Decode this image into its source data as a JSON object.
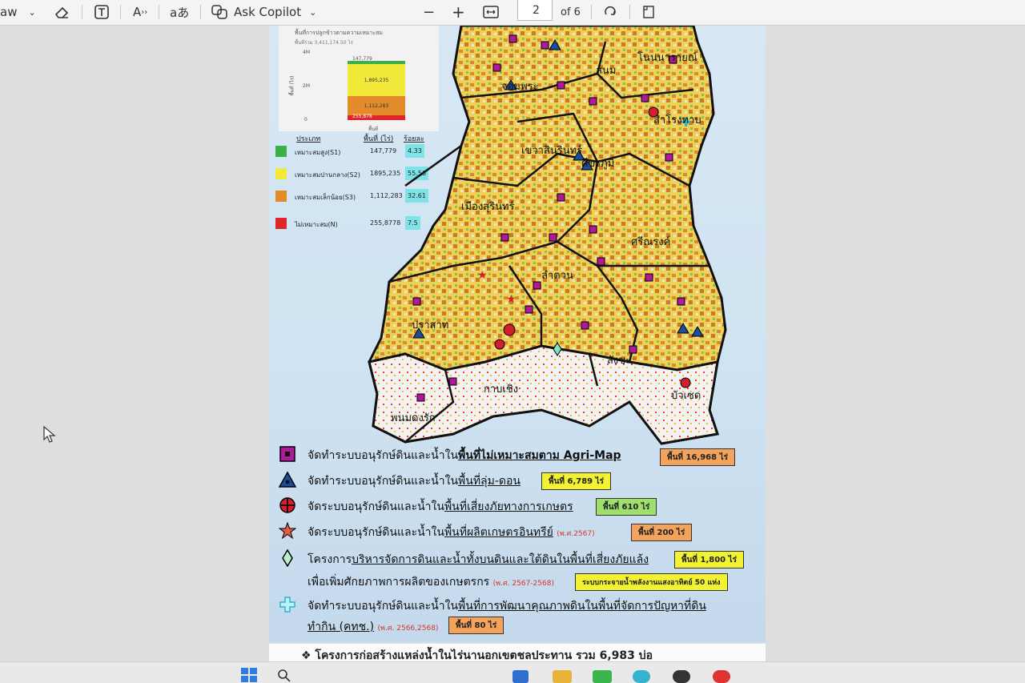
{
  "toolbar": {
    "draw_label": "aw",
    "ask_copilot": "Ask Copilot",
    "page_current": "2",
    "page_of": "of 6",
    "minus": "−",
    "plus": "+"
  },
  "chart": {
    "title": "พื้นที่การปลูกข้าวตามความเหมาะสม",
    "subtitle": "พื้นที่รวม 3,411,174.50 ไร่",
    "yticks": [
      "4M",
      "2M",
      "0"
    ],
    "ylabel": "พื้นที่ (ไร่)",
    "xlabel": "พื้นที่",
    "segments": [
      "147,779",
      "1,895,235",
      "1,112,283",
      "255,878"
    ]
  },
  "legend_table": {
    "col_type": "ประเภท",
    "col_area": "พื้นที่ (ไร่)",
    "col_pct": "ร้อยละ",
    "rows": [
      {
        "name": "เหมาะสมสูง(S1)",
        "area": "147,779",
        "pct": "4.33",
        "color": "#3cae4a"
      },
      {
        "name": "เหมาะสมปานกลาง(S2)",
        "area": "1895,235",
        "pct": "55.56",
        "color": "#f2e93a"
      },
      {
        "name": "เหมาะสมเล็กน้อย(S3)",
        "area": "1,112,283",
        "pct": "32.61",
        "color": "#e38a2b"
      },
      {
        "name": "ไม่เหมาะสม(N)",
        "area": "255,8778",
        "pct": "7.5",
        "color": "#e0262a"
      }
    ]
  },
  "map_labels": [
    "โนนนารายณ์",
    "สนม",
    "สำโรงทาบ",
    "ศีขรภูมิ",
    "เขวาสินรินทร์",
    "เมืองสุรินทร์",
    "ศรีณรงค์",
    "ลำดวน",
    "ปราสาท",
    "สังขะ",
    "กาบเชิง",
    "บัวเชด",
    "พนมดงรัก",
    "จอมพระ"
  ],
  "legend": [
    {
      "pre": "จัดทำระบบอนุรักษ์ดินและน้ำใน",
      "under": "พื้นที่ไม่เหมาะสมตาม Agri-Map",
      "post": "",
      "year": "",
      "badge": "พื้นที่ 16,968 ไร่"
    },
    {
      "pre": "จัดทำระบบอนุรักษ์ดินและน้ำใน",
      "under": "พื้นที่ลุ่ม-ดอน",
      "post": "",
      "year": "",
      "badge": "พื้นที่ 6,789 ไร่"
    },
    {
      "pre": "จัดระบบอนุรักษ์ดินและน้ำใน",
      "under": "พื้นที่เสี่ยงภัยทางการเกษตร",
      "post": "",
      "year": "",
      "badge": "พื้นที่ 610 ไร่"
    },
    {
      "pre": "จัดระบบอนุรักษ์ดินและน้ำใน",
      "under": "พื้นที่ผลิตเกษตรอินทรีย์",
      "post": "",
      "year": "(พ.ศ.2567)",
      "badge": "พื้นที่ 200 ไร่"
    },
    {
      "pre": "โครงการ",
      "under": "บริหารจัดการดินและน้ำทั้งบนดินและใต้ดินในพื้นที่เสี่ยงภัยแล้ง",
      "post": "",
      "year": "",
      "badge": "พื้นที่ 1,800 ไร่",
      "line2": "เพื่อเพิ่มศักยภาพการผลิตของเกษตรกร",
      "year2": "(พ.ศ. 2567-2568)",
      "badge2": "ระบบกระจายน้ำพลังงานแสงอาทิตย์ 50 แห่ง"
    },
    {
      "pre": "จัดทำระบบอนุรักษ์ดินและน้ำใน",
      "under": "พื้นที่การพัฒนาคุณภาพดินในพื้นที่จัดการปัญหาที่ดิน",
      "post": "",
      "year": "",
      "badge": "พื้นที่ 80 ไร่",
      "line2": "ทำกิน (คทช.)",
      "year2": "(พ.ศ. 2566,2568)"
    }
  ],
  "bottom_text": "❖ โครงการก่อสร้างแหล่งน้ำในไร่นานอกเขตชลประทาน   รวม 6,983 บ่อ",
  "colors": {
    "magenta": "#b0199a",
    "blue": "#1c4e9e",
    "red": "#d2202a",
    "cyan": "#2fb4c8"
  }
}
